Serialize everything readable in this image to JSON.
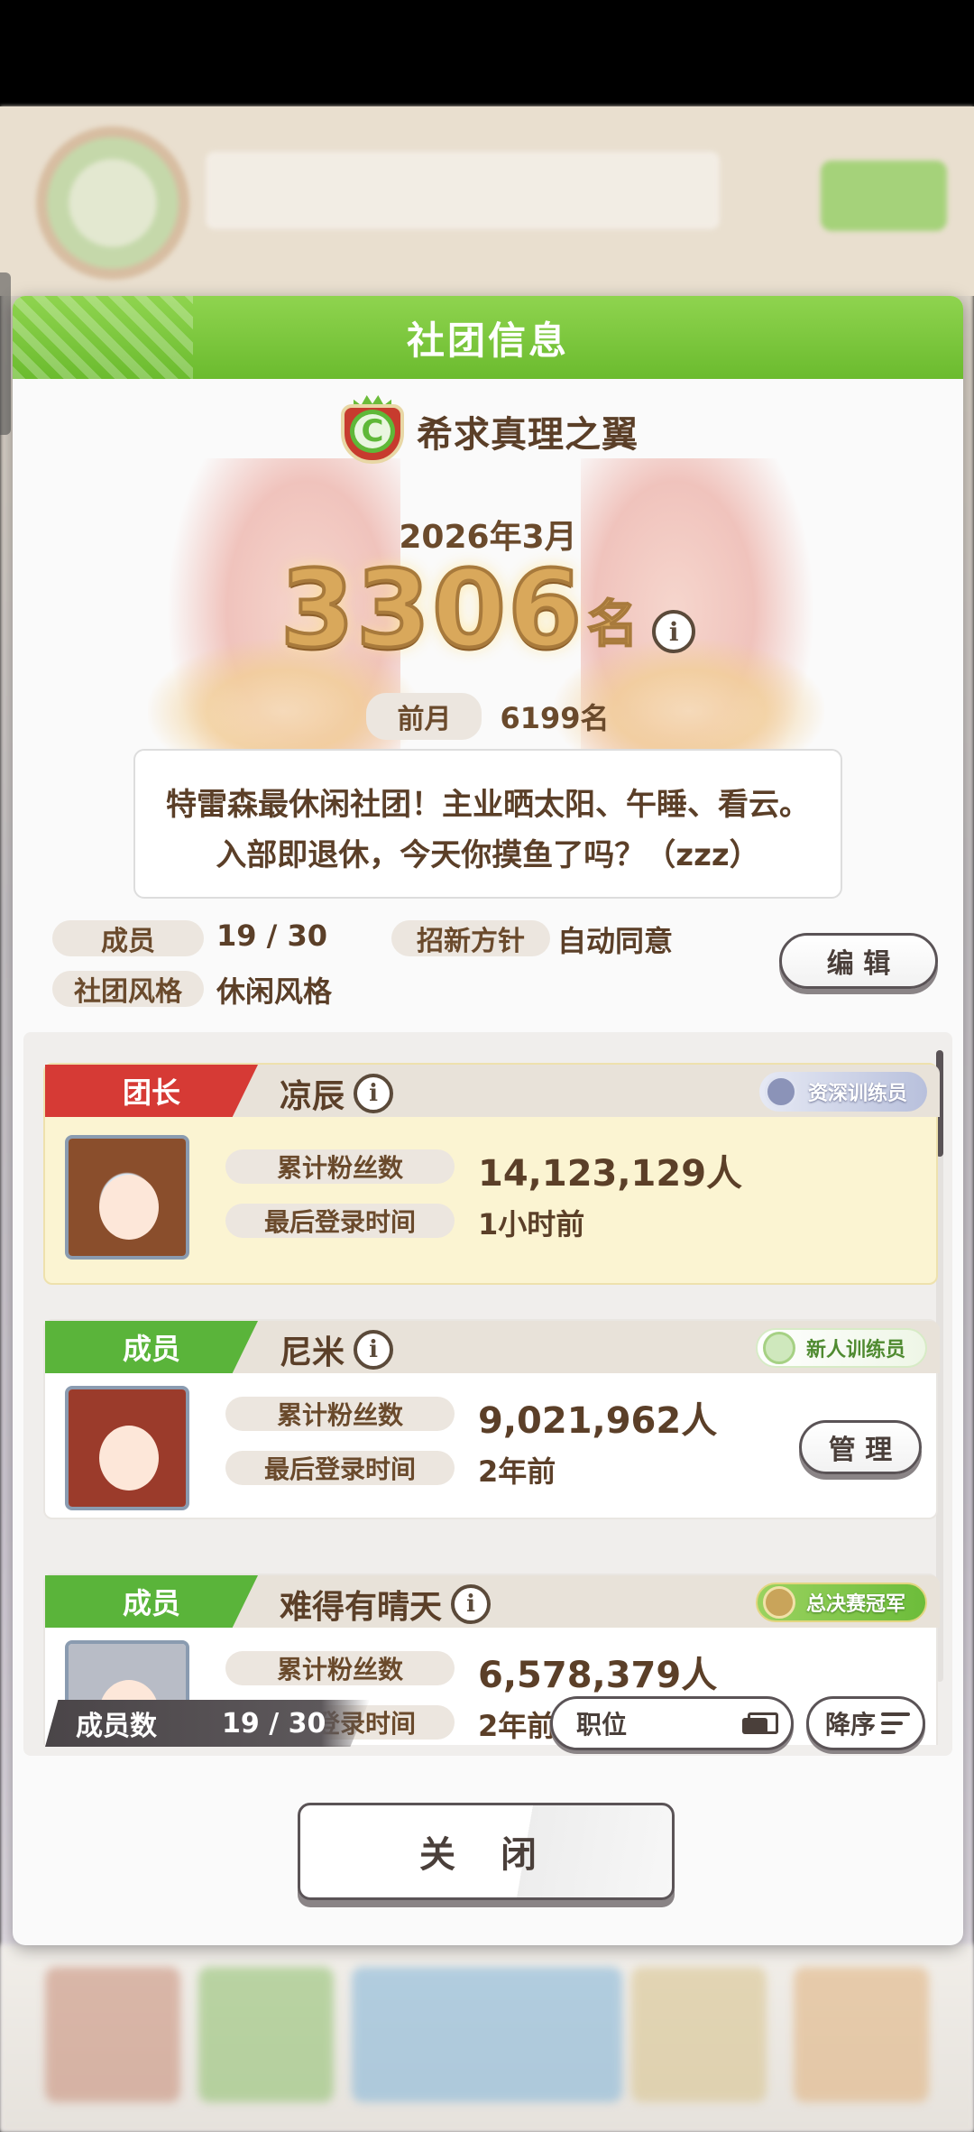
{
  "dialog": {
    "title": "社团信息"
  },
  "club": {
    "name": "希求真理之翼",
    "rank_month": "2026年3月",
    "rank_number": "3306",
    "rank_unit": "名",
    "prev_label": "前月",
    "prev_value": "6199名",
    "description": "特雷森最休闲社团！主业晒太阳、午睡、看云。入部即退休，今天你摸鱼了吗？（zzz）",
    "members_label": "成员",
    "members_value": "19 / 30",
    "policy_label": "招新方针",
    "policy_value": "自动同意",
    "style_label": "社团风格",
    "style_value": "休闲风格",
    "edit_button": "编 辑"
  },
  "members": [
    {
      "role": "团长",
      "name": "凉辰",
      "title": "资深训练员",
      "fans_label": "累计粉丝数",
      "fans_value": "14,123,129人",
      "login_label": "最后登录时间",
      "login_value": "1小时前"
    },
    {
      "role": "成员",
      "name": "尼米",
      "title": "新人训练员",
      "fans_label": "累计粉丝数",
      "fans_value": "9,021,962人",
      "login_label": "最后登录时间",
      "login_value": "2年前",
      "manage_button": "管 理"
    },
    {
      "role": "成员",
      "name": "难得有晴天",
      "title": "总决赛冠军",
      "fans_label": "累计粉丝数",
      "fans_value": "6,578,379人",
      "login_label": "最后登录时间",
      "login_value": "2年前"
    }
  ],
  "list_footer": {
    "count_label": "成员数",
    "count_value": "19 / 30",
    "sort_field": "职位",
    "sort_order": "降序"
  },
  "close_button": "关 闭",
  "colors": {
    "header_green": "#6bbb2e",
    "leader_red": "#d63a35",
    "member_green": "#5ab43a",
    "rank_gold": "#d9a85b"
  },
  "icons": [
    "club-crest-icon",
    "info-icon",
    "title-badge-icon",
    "cards-icon",
    "sort-icon"
  ]
}
